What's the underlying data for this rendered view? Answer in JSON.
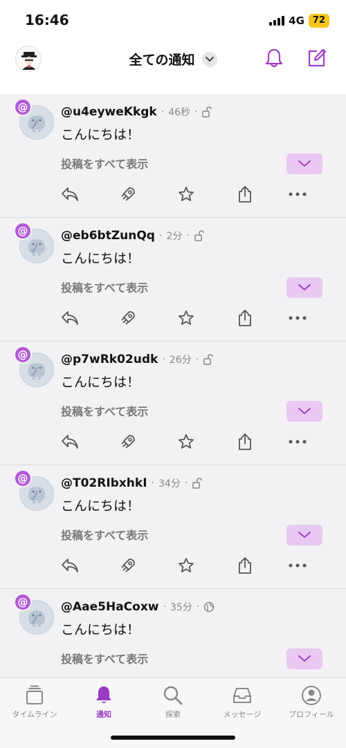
{
  "status": {
    "time": "16:46",
    "network": "4G",
    "battery": "72"
  },
  "header": {
    "title": "全ての通知"
  },
  "notes": [
    {
      "username": "@u4eyweKkgk",
      "time": "46秒",
      "visibility": "lock-icon",
      "text": "こんにちは！",
      "show_all": "投稿をすべて表示"
    },
    {
      "username": "@eb6btZunQq",
      "time": "2分",
      "visibility": "lock-icon",
      "text": "こんにちは！",
      "show_all": "投稿をすべて表示"
    },
    {
      "username": "@p7wRk02udk",
      "time": "26分",
      "visibility": "lock-icon",
      "text": "こんにちは！",
      "show_all": "投稿をすべて表示"
    },
    {
      "username": "@T02RIbxhkI",
      "time": "34分",
      "visibility": "lock-icon",
      "text": "こんにちは！",
      "show_all": "投稿をすべて表示"
    },
    {
      "username": "@Aae5HaCoxw",
      "time": "35分",
      "visibility": "globe-icon",
      "text": "こんにちは！",
      "show_all": "投稿をすべて表示"
    }
  ],
  "tabs": [
    {
      "label": "タイムライン",
      "icon": "timeline-icon"
    },
    {
      "label": "通知",
      "icon": "bell-icon",
      "active": true
    },
    {
      "label": "探索",
      "icon": "search-icon"
    },
    {
      "label": "メッセージ",
      "icon": "inbox-icon"
    },
    {
      "label": "プロフィール",
      "icon": "profile-icon"
    }
  ],
  "colors": {
    "accent": "#9b3ac2",
    "mention_badge": "#b25ad6",
    "expand_bg": "#e9c8f2"
  }
}
